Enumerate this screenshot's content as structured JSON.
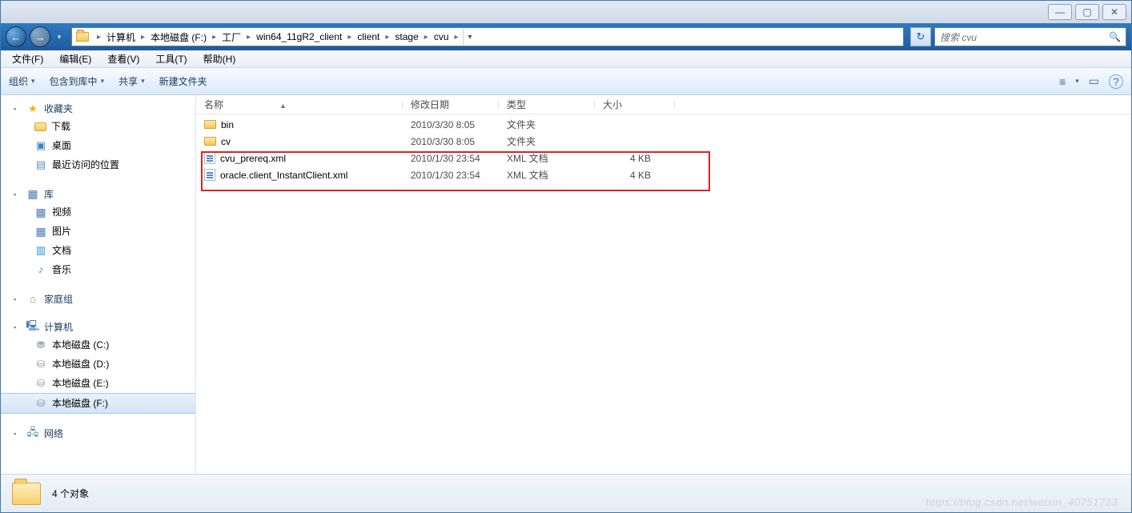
{
  "titlebar": {
    "min": "—",
    "max": "▢",
    "close": "✕"
  },
  "nav": {
    "back": "←",
    "forward": "→",
    "dropdown": "▾",
    "crumbs": [
      "计算机",
      "本地磁盘 (F:)",
      "工厂",
      "win64_11gR2_client",
      "client",
      "stage",
      "cvu"
    ],
    "refresh": "↻",
    "search_placeholder": "搜索 cvu",
    "search_icon": "🔍"
  },
  "menubar": {
    "items": [
      {
        "label": "文件(F)"
      },
      {
        "label": "编辑(E)"
      },
      {
        "label": "查看(V)"
      },
      {
        "label": "工具(T)"
      },
      {
        "label": "帮助(H)"
      }
    ]
  },
  "toolbar": {
    "organize": "组织",
    "include": "包含到库中",
    "share": "共享",
    "newfolder": "新建文件夹",
    "drop": "▾",
    "views": "≡",
    "preview": "▭",
    "help": "?"
  },
  "navpane": {
    "favorites": {
      "label": "收藏夹",
      "items": [
        {
          "icon": "folder",
          "label": "下载"
        },
        {
          "icon": "desk",
          "label": "桌面"
        },
        {
          "icon": "recent",
          "label": "最近访问的位置"
        }
      ]
    },
    "libraries": {
      "label": "库",
      "items": [
        {
          "icon": "lib",
          "label": "视频"
        },
        {
          "icon": "lib",
          "label": "图片"
        },
        {
          "icon": "note",
          "label": "文档"
        },
        {
          "icon": "note",
          "label": "音乐"
        }
      ]
    },
    "homegroup": {
      "label": "家庭组"
    },
    "computer": {
      "label": "计算机",
      "items": [
        {
          "icon": "disk",
          "label": "本地磁盘 (C:)"
        },
        {
          "icon": "disk",
          "label": "本地磁盘 (D:)"
        },
        {
          "icon": "disk",
          "label": "本地磁盘 (E:)"
        },
        {
          "icon": "disk",
          "label": "本地磁盘 (F:)",
          "selected": true
        }
      ]
    },
    "network": {
      "label": "网络"
    }
  },
  "columns": {
    "name": "名称",
    "date": "修改日期",
    "type": "类型",
    "size": "大小",
    "sort": "▲"
  },
  "files": [
    {
      "icon": "folder",
      "name": "bin",
      "date": "2010/3/30 8:05",
      "type": "文件夹",
      "size": ""
    },
    {
      "icon": "folder",
      "name": "cv",
      "date": "2010/3/30 8:05",
      "type": "文件夹",
      "size": ""
    },
    {
      "icon": "xml",
      "name": "cvu_prereq.xml",
      "date": "2010/1/30 23:54",
      "type": "XML 文档",
      "size": "4 KB"
    },
    {
      "icon": "xml",
      "name": "oracle.client_InstantClient.xml",
      "date": "2010/1/30 23:54",
      "type": "XML 文档",
      "size": "4 KB"
    }
  ],
  "status": {
    "text": "4 个对象"
  },
  "watermark": "https://blog.csdn.net/weixin_40751723"
}
